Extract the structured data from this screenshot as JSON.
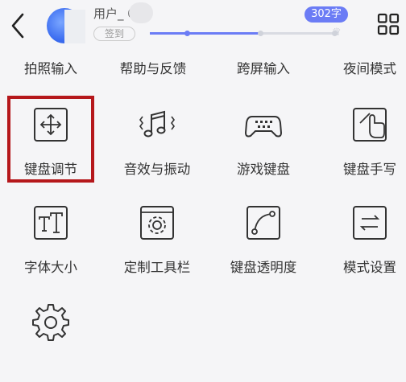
{
  "header": {
    "username": "用户_   03",
    "signin_label": "签到",
    "word_count": "302字",
    "progress": 0.59
  },
  "top_menu": [
    {
      "label": "拍照输入"
    },
    {
      "label": "帮助与反馈"
    },
    {
      "label": "跨屏输入"
    },
    {
      "label": "夜间模式"
    }
  ],
  "tiles": [
    {
      "label": "键盘调节",
      "icon": "move-arrows-icon",
      "highlighted": true
    },
    {
      "label": "音效与振动",
      "icon": "music-vibration-icon"
    },
    {
      "label": "游戏键盘",
      "icon": "gamepad-icon"
    },
    {
      "label": "键盘手写",
      "icon": "handwriting-icon"
    },
    {
      "label": "字体大小",
      "icon": "font-size-icon"
    },
    {
      "label": "定制工具栏",
      "icon": "custom-toolbar-icon"
    },
    {
      "label": "键盘透明度",
      "icon": "transparency-curve-icon"
    },
    {
      "label": "模式设置",
      "icon": "mode-switch-icon"
    },
    {
      "label": "",
      "icon": "settings-gear-icon"
    }
  ],
  "colors": {
    "accent": "#6b7cf5",
    "highlight_border": "#b5171b"
  }
}
